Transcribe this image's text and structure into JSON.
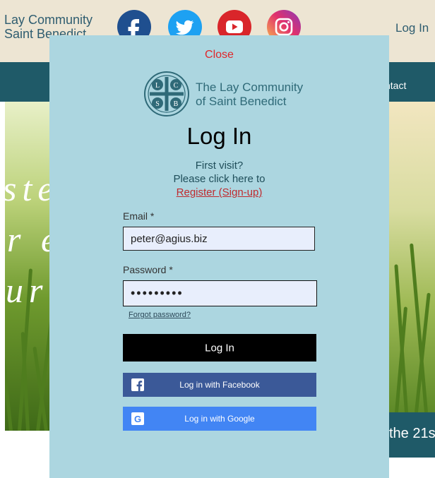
{
  "site": {
    "name_line1": "Lay Community",
    "name_line2": "Saint Benedict",
    "header_login": "Log In",
    "nav_contact": "ntact",
    "hero_fragments": [
      "ste",
      "r e",
      "ur"
    ],
    "band_text": "the 21s"
  },
  "social": {
    "icons": [
      "facebook-icon",
      "twitter-icon",
      "youtube-icon",
      "instagram-icon"
    ]
  },
  "modal": {
    "close_label": "Close",
    "logo_line1": "The Lay Community",
    "logo_line2": "of Saint Benedict",
    "logo_letters": [
      "L",
      "C",
      "S",
      "B"
    ],
    "title": "Log In",
    "first_visit_line1": "First visit?",
    "first_visit_line2": "Please click here to",
    "register_link": "Register (Sign-up)",
    "email_label": "Email *",
    "email_value": "peter@agius.biz",
    "password_label": "Password *",
    "password_value": "•••••••••",
    "forgot_password": "Forgot password?",
    "login_button": "Log In",
    "facebook_button": "Log in with Facebook",
    "google_button": "Log in with Google"
  },
  "colors": {
    "modal_bg": "#acd6e0",
    "close": "#e0272a",
    "teal_dark": "#1f5a68",
    "facebook": "#3b5998",
    "google": "#4285f4"
  }
}
